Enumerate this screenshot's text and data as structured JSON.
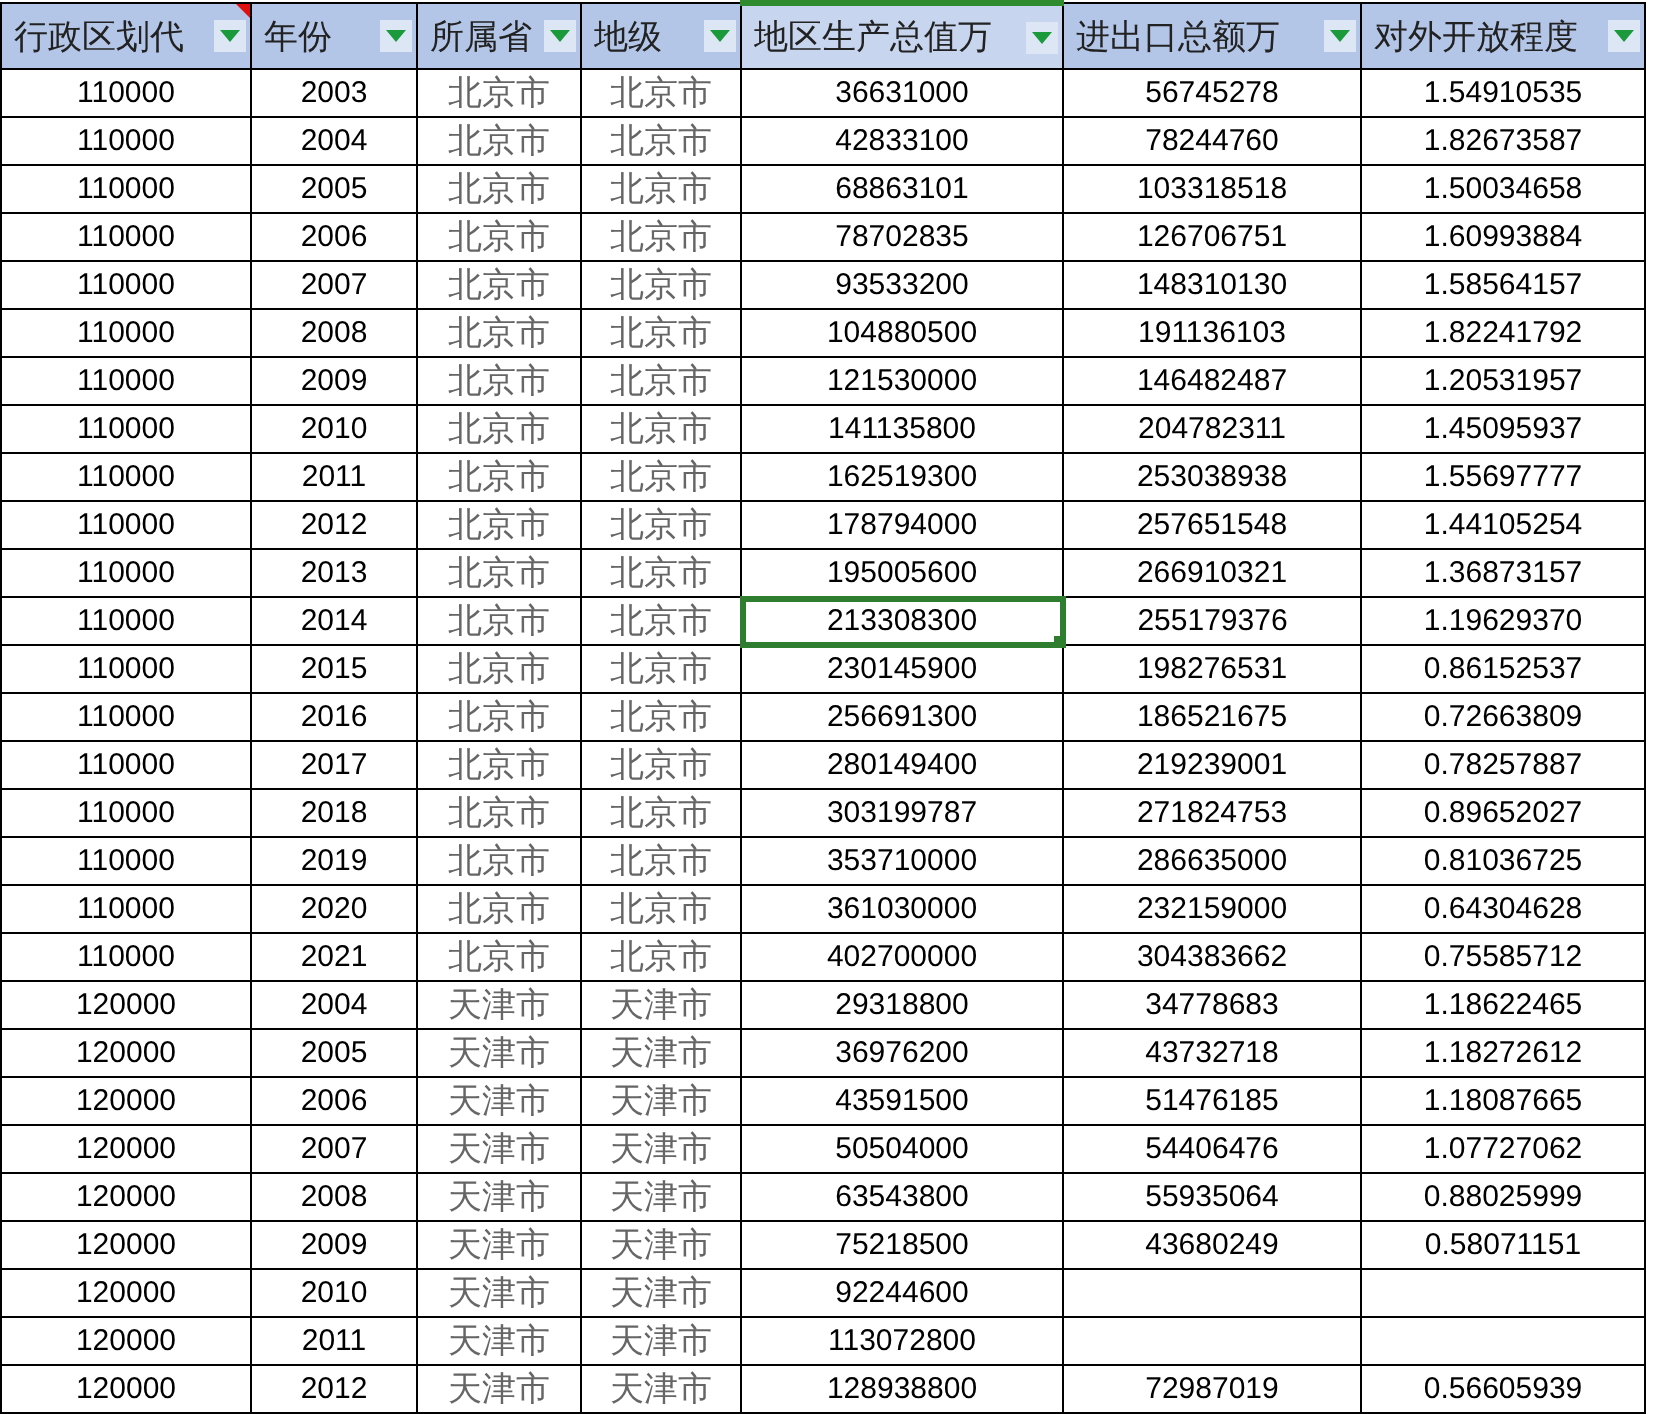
{
  "columns": [
    {
      "label": "行政区划代",
      "filter": true,
      "comment": true,
      "selected": false
    },
    {
      "label": "年份",
      "filter": true,
      "comment": false,
      "selected": false
    },
    {
      "label": "所属省",
      "filter": true,
      "comment": false,
      "selected": false
    },
    {
      "label": "地级",
      "filter": true,
      "comment": false,
      "selected": false
    },
    {
      "label": "地区生产总值万",
      "filter": true,
      "comment": false,
      "selected": true
    },
    {
      "label": "进出口总额万",
      "filter": true,
      "comment": false,
      "selected": false
    },
    {
      "label": "对外开放程度",
      "filter": true,
      "comment": false,
      "selected": false
    }
  ],
  "rows": [
    {
      "selected": false,
      "cells": [
        "110000",
        "2003",
        "北京市",
        "北京市",
        "36631000",
        "56745278",
        "1.54910535"
      ]
    },
    {
      "selected": false,
      "cells": [
        "110000",
        "2004",
        "北京市",
        "北京市",
        "42833100",
        "78244760",
        "1.82673587"
      ]
    },
    {
      "selected": false,
      "cells": [
        "110000",
        "2005",
        "北京市",
        "北京市",
        "68863101",
        "103318518",
        "1.50034658"
      ]
    },
    {
      "selected": false,
      "cells": [
        "110000",
        "2006",
        "北京市",
        "北京市",
        "78702835",
        "126706751",
        "1.60993884"
      ]
    },
    {
      "selected": false,
      "cells": [
        "110000",
        "2007",
        "北京市",
        "北京市",
        "93533200",
        "148310130",
        "1.58564157"
      ]
    },
    {
      "selected": false,
      "cells": [
        "110000",
        "2008",
        "北京市",
        "北京市",
        "104880500",
        "191136103",
        "1.82241792"
      ]
    },
    {
      "selected": false,
      "cells": [
        "110000",
        "2009",
        "北京市",
        "北京市",
        "121530000",
        "146482487",
        "1.20531957"
      ]
    },
    {
      "selected": false,
      "cells": [
        "110000",
        "2010",
        "北京市",
        "北京市",
        "141135800",
        "204782311",
        "1.45095937"
      ]
    },
    {
      "selected": false,
      "cells": [
        "110000",
        "2011",
        "北京市",
        "北京市",
        "162519300",
        "253038938",
        "1.55697777"
      ]
    },
    {
      "selected": false,
      "cells": [
        "110000",
        "2012",
        "北京市",
        "北京市",
        "178794000",
        "257651548",
        "1.44105254"
      ]
    },
    {
      "selected": false,
      "cells": [
        "110000",
        "2013",
        "北京市",
        "北京市",
        "195005600",
        "266910321",
        "1.36873157"
      ]
    },
    {
      "selected": true,
      "cells": [
        "110000",
        "2014",
        "北京市",
        "北京市",
        "213308300",
        "255179376",
        "1.19629370"
      ]
    },
    {
      "selected": false,
      "cells": [
        "110000",
        "2015",
        "北京市",
        "北京市",
        "230145900",
        "198276531",
        "0.86152537"
      ]
    },
    {
      "selected": false,
      "cells": [
        "110000",
        "2016",
        "北京市",
        "北京市",
        "256691300",
        "186521675",
        "0.72663809"
      ]
    },
    {
      "selected": false,
      "cells": [
        "110000",
        "2017",
        "北京市",
        "北京市",
        "280149400",
        "219239001",
        "0.78257887"
      ]
    },
    {
      "selected": false,
      "cells": [
        "110000",
        "2018",
        "北京市",
        "北京市",
        "303199787",
        "271824753",
        "0.89652027"
      ]
    },
    {
      "selected": false,
      "cells": [
        "110000",
        "2019",
        "北京市",
        "北京市",
        "353710000",
        "286635000",
        "0.81036725"
      ]
    },
    {
      "selected": false,
      "cells": [
        "110000",
        "2020",
        "北京市",
        "北京市",
        "361030000",
        "232159000",
        "0.64304628"
      ]
    },
    {
      "selected": false,
      "cells": [
        "110000",
        "2021",
        "北京市",
        "北京市",
        "402700000",
        "304383662",
        "0.75585712"
      ]
    },
    {
      "selected": false,
      "cells": [
        "120000",
        "2004",
        "天津市",
        "天津市",
        "29318800",
        "34778683",
        "1.18622465"
      ]
    },
    {
      "selected": false,
      "cells": [
        "120000",
        "2005",
        "天津市",
        "天津市",
        "36976200",
        "43732718",
        "1.18272612"
      ]
    },
    {
      "selected": false,
      "cells": [
        "120000",
        "2006",
        "天津市",
        "天津市",
        "43591500",
        "51476185",
        "1.18087665"
      ]
    },
    {
      "selected": false,
      "cells": [
        "120000",
        "2007",
        "天津市",
        "天津市",
        "50504000",
        "54406476",
        "1.07727062"
      ]
    },
    {
      "selected": false,
      "cells": [
        "120000",
        "2008",
        "天津市",
        "天津市",
        "63543800",
        "55935064",
        "0.88025999"
      ]
    },
    {
      "selected": false,
      "cells": [
        "120000",
        "2009",
        "天津市",
        "天津市",
        "75218500",
        "43680249",
        "0.58071151"
      ]
    },
    {
      "selected": false,
      "cells": [
        "120000",
        "2010",
        "天津市",
        "天津市",
        "92244600",
        null,
        null
      ]
    },
    {
      "selected": false,
      "cells": [
        "120000",
        "2011",
        "天津市",
        "天津市",
        "113072800",
        null,
        null
      ]
    },
    {
      "selected": false,
      "cells": [
        "120000",
        "2012",
        "天津市",
        "天津市",
        "128938800",
        "72987019",
        "0.56605939"
      ]
    }
  ]
}
